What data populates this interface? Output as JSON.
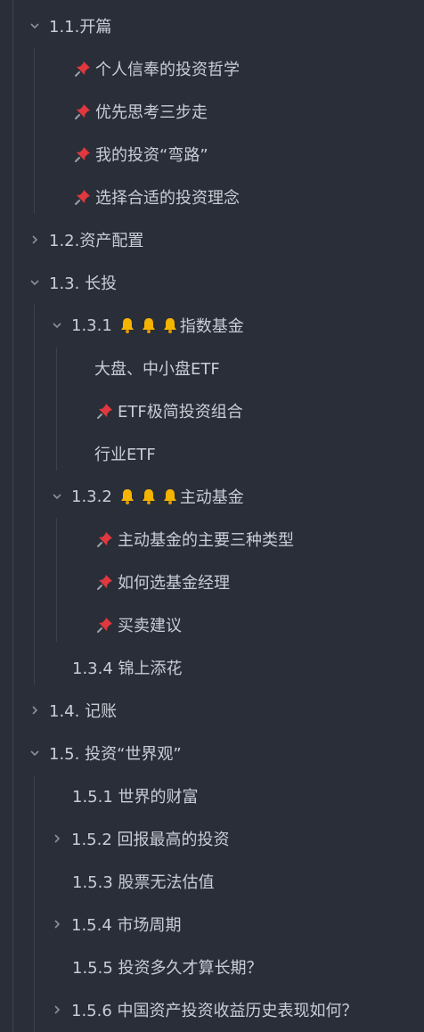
{
  "items": {
    "i0": "1.1.开篇",
    "i1": "个人信奉的投资哲学",
    "i2": "优先思考三步走",
    "i3": "我的投资“弯路”",
    "i4": "选择合适的投资理念",
    "i5": "1.2.资产配置",
    "i6": "1.3. 长投",
    "i7_num": "1.3.1",
    "i7_text": "指数基金",
    "i8": "大盘、中小盘ETF",
    "i9": "ETF极简投资组合",
    "i10": "行业ETF",
    "i11_num": "1.3.2",
    "i11_text": "主动基金",
    "i12": "主动基金的主要三种类型",
    "i13": "如何选基金经理",
    "i14": "买卖建议",
    "i15": "1.3.4 锦上添花",
    "i16": "1.4. 记账",
    "i17": "1.5. 投资“世界观”",
    "i18": "1.5.1 世界的财富",
    "i19": "1.5.2 回报最高的投资",
    "i20": "1.5.3 股票无法估值",
    "i21": "1.5.4 市场周期",
    "i22": "1.5.5 投资多久才算长期？",
    "i23": "1.5.6 中国资产投资收益历史表现如何？"
  },
  "icons": {
    "expanded": "chevron-down-icon",
    "collapsed": "chevron-right-icon",
    "pin": "pushpin-icon",
    "bell": "bell-icon"
  },
  "colors": {
    "background": "#2a2e38",
    "text": "#c9cdd6",
    "guide_line": "#3c414d",
    "chevron": "#8a909c",
    "pin_red": "#e0383e",
    "bell_gold": "#f4b400"
  }
}
